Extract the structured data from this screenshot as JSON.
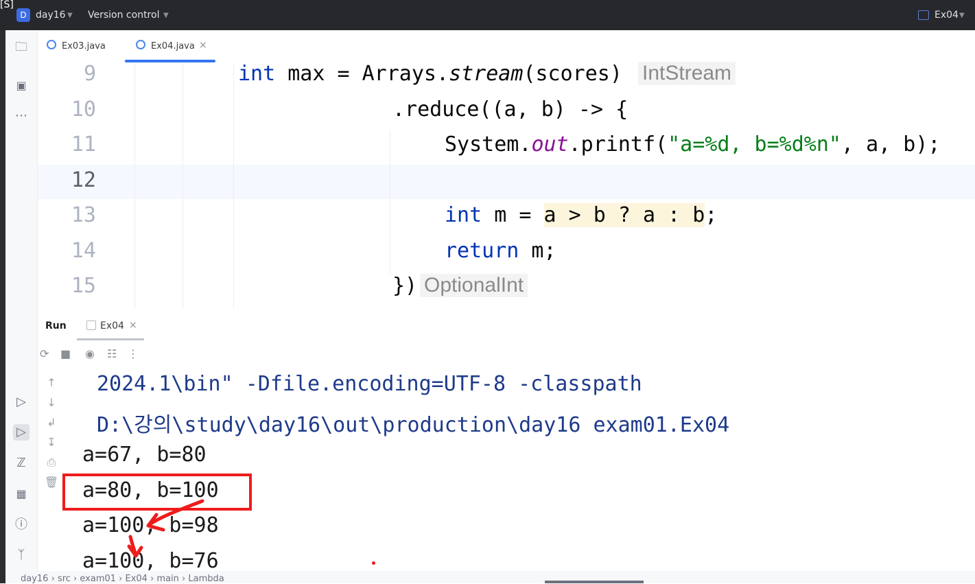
{
  "topleft_tag": "[S]",
  "titlebar": {
    "project_badge": "D",
    "project_name": "day16",
    "vcs": "Version control",
    "run_config": "Ex04"
  },
  "tabs": [
    {
      "label": "Ex03.java"
    },
    {
      "label": "Ex04.java"
    }
  ],
  "editor": {
    "line_numbers": [
      "9",
      "10",
      "11",
      "12",
      "13",
      "14",
      "15"
    ],
    "line9": {
      "kw": "int",
      "rest1": " max = Arrays.",
      "method": "stream",
      "rest2": "(scores)",
      "hint": "IntStream"
    },
    "line10": {
      "code": ".reduce((a, b) -> {"
    },
    "line11": {
      "p1": "System.",
      "field": "out",
      "p2": ".printf(",
      "str": "\"a=%d, b=%d%n\"",
      "p3": ", a, b);"
    },
    "line13": {
      "kw": "int",
      "var": " m = ",
      "expr": "a > b ? a : b",
      "end": ";"
    },
    "line14": {
      "kw": "return",
      "rest": " m;"
    },
    "line15": {
      "code": "})",
      "hint": "OptionalInt"
    }
  },
  "run_panel": {
    "title": "Run",
    "tab": "Ex04"
  },
  "console": {
    "lines": [
      "2024.1\\bin\" -Dfile.encoding=UTF-8 -classpath",
      "D:\\강의\\study\\day16\\out\\production\\day16 exam01.Ex04",
      "a=67, b=80",
      "a=80, b=100",
      "a=100, b=98",
      "a=100, b=76"
    ]
  },
  "statusbar": {
    "crumbs": [
      "day16",
      "src",
      "exam01",
      "Ex04",
      "main",
      "Lambda"
    ]
  },
  "colors": {
    "keyword": "#0033b3",
    "string": "#067d17",
    "field": "#871094",
    "annotation_red": "#ee1c1c",
    "accent": "#3574f0"
  }
}
